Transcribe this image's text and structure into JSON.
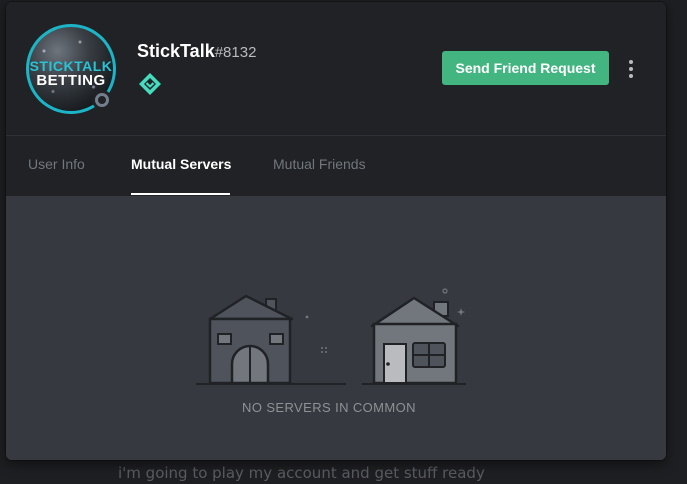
{
  "profile": {
    "username": "StickTalk",
    "discriminator": "#8132",
    "avatar_text_line1": "STICKTALK",
    "avatar_text_line2": "BETTING",
    "status": "offline",
    "badge_icon": "hypesquad-balance-badge-icon"
  },
  "actions": {
    "send_friend_request_label": "Send Friend Request",
    "more_icon": "vertical-ellipsis-icon"
  },
  "tabs": [
    {
      "label": "User Info",
      "active": false
    },
    {
      "label": "Mutual Servers",
      "active": true
    },
    {
      "label": "Mutual Friends",
      "active": false
    }
  ],
  "empty_state": {
    "message": "NO SERVERS IN COMMON",
    "icon": "two-houses-no-connection-icon"
  },
  "background": {
    "chat_message_text": "i'm going to play my account and get stuff ready"
  },
  "colors": {
    "accent_green": "#43b581",
    "badge_teal": "#45ddc0",
    "x_red": "#f04747",
    "header_bg": "#202225",
    "body_bg": "#36393f"
  }
}
